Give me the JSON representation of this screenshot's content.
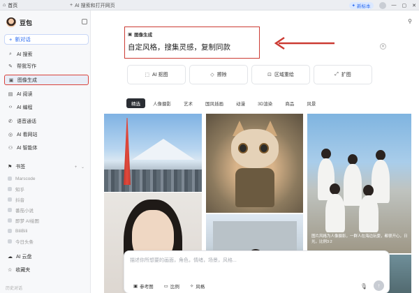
{
  "titlebar": {
    "home_tab": "首页",
    "new_tab_label": "AI 搜索和打开网页",
    "badge_label": "新标本",
    "window_controls": [
      "—",
      "▢",
      "✕"
    ]
  },
  "sidebar": {
    "brand": "豆包",
    "new_chat": "新对话",
    "items": [
      {
        "label": "AI 搜索",
        "icon": "search-icon"
      },
      {
        "label": "帮我写作",
        "icon": "pen-icon"
      },
      {
        "label": "图像生成",
        "icon": "image-icon",
        "active": true
      },
      {
        "label": "AI 阅读",
        "icon": "book-icon"
      },
      {
        "label": "AI 编程",
        "icon": "code-icon"
      },
      {
        "label": "语音通话",
        "icon": "phone-icon"
      },
      {
        "label": "AI 看网站",
        "icon": "globe-icon"
      },
      {
        "label": "AI 智能体",
        "icon": "agent-icon"
      }
    ],
    "bookmarks_title": "书签",
    "bookmarks": [
      "Marscode",
      "知乎",
      "抖音",
      "番茄小说",
      "即梦 AI绘图",
      "BiliBili",
      "今日头条"
    ],
    "bottom_items": [
      {
        "label": "AI 云盘",
        "icon": "cloud-icon"
      },
      {
        "label": "收藏夹",
        "icon": "star-icon"
      }
    ],
    "footer": "历史对话"
  },
  "main": {
    "hero_tag": "图像生成",
    "hero_title": "自定风格，搜集灵感，复制同款",
    "tools": [
      {
        "label": "AI 抠图",
        "icon": "cutout-icon"
      },
      {
        "label": "擦除",
        "icon": "eraser-icon"
      },
      {
        "label": "区域重绘",
        "icon": "region-icon"
      },
      {
        "label": "扩图",
        "icon": "expand-icon"
      }
    ],
    "categories": [
      "精选",
      "人像摄影",
      "艺术",
      "国风插画",
      "动漫",
      "3D渲染",
      "商品",
      "风景"
    ],
    "active_category": "精选",
    "beach_caption": "图片风格为人像摄影，一群人在海边玩耍，都很开心，日光，比例3:2",
    "composer": {
      "placeholder": "描述你所想要的画面，角色，情绪，场景，风格...",
      "buttons": [
        {
          "label": "参考图",
          "icon": "image-icon"
        },
        {
          "label": "比例",
          "icon": "ratio-icon"
        },
        {
          "label": "风格",
          "icon": "style-icon"
        }
      ]
    }
  },
  "colors": {
    "accent": "#2d6cf0",
    "highlight_box": "#cc3b33"
  }
}
